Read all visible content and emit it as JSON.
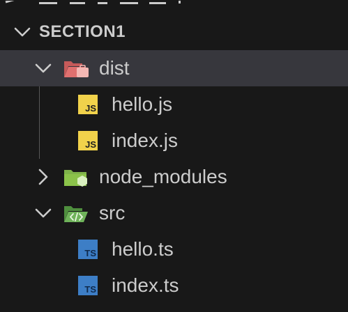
{
  "section": {
    "title": "SECTION1"
  },
  "tree": {
    "dist": {
      "label": "dist",
      "files": [
        {
          "label": "hello.js",
          "badge": "JS"
        },
        {
          "label": "index.js",
          "badge": "JS"
        }
      ]
    },
    "node_modules": {
      "label": "node_modules"
    },
    "src": {
      "label": "src",
      "files": [
        {
          "label": "hello.ts",
          "badge": "TS"
        },
        {
          "label": "index.ts",
          "badge": "TS"
        }
      ]
    }
  },
  "colors": {
    "background": "#181818",
    "selected_row": "#37373d",
    "text": "#cccccc",
    "js_badge": "#f1d24b",
    "ts_badge": "#3d7ec6",
    "dist_folder": "#e0706f",
    "node_folder": "#8bc34a",
    "src_folder": "#6fb35a"
  },
  "icons": {
    "section_chevron": "chevron-down-icon",
    "dist_folder": "folder-open-dist-icon",
    "node_folder": "folder-node-icon",
    "src_folder": "folder-open-src-icon"
  }
}
